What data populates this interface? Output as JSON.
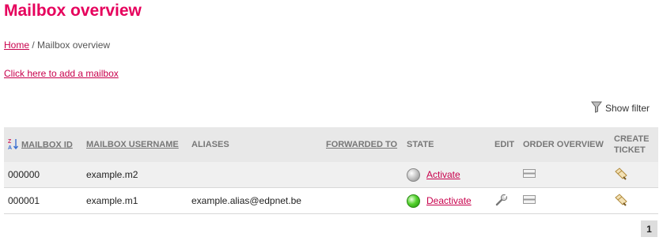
{
  "page_title": "Mailbox overview",
  "breadcrumb": {
    "home": "Home",
    "separator": "/",
    "current": "Mailbox overview"
  },
  "add_mailbox_link": "Click here to add a mailbox",
  "filter": {
    "label": "Show filter",
    "icon": "funnel-icon"
  },
  "table": {
    "headers": {
      "mailbox_id": "MAILBOX ID",
      "username": "MAILBOX USERNAME",
      "aliases": "ALIASES",
      "forwarded_to": "FORWARDED TO",
      "state": "STATE",
      "edit": "EDIT",
      "order_overview": "ORDER OVERVIEW",
      "create_ticket_line1": "CREATE",
      "create_ticket_line2": "TICKET"
    },
    "rows": [
      {
        "id": "000000",
        "username": "example.m2",
        "aliases": "",
        "forwarded_to": "",
        "state_icon": "grey-orb",
        "state_action": "Activate",
        "editable": false
      },
      {
        "id": "000001",
        "username": "example.m1",
        "aliases": "example.alias@edpnet.be",
        "forwarded_to": "",
        "state_icon": "green-orb",
        "state_action": "Deactivate",
        "editable": true
      }
    ]
  },
  "pagination": {
    "current_page": "1"
  },
  "colors": {
    "accent": "#e6005c",
    "link": "#c8004c",
    "header_bg": "#e8e8e8",
    "row_alt": "#f0f0f0"
  }
}
